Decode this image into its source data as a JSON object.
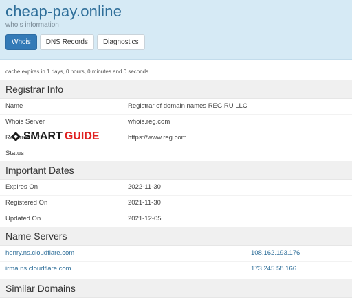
{
  "header": {
    "domain": "cheap-pay.online",
    "subtitle": "whois information",
    "tabs": [
      {
        "label": "Whois",
        "active": true
      },
      {
        "label": "DNS Records",
        "active": false
      },
      {
        "label": "Diagnostics",
        "active": false
      }
    ]
  },
  "cache_note": "cache expires in 1 days, 0 hours, 0 minutes and 0 seconds",
  "registrar": {
    "title": "Registrar Info",
    "rows": [
      {
        "key": "Name",
        "value": "Registrar of domain names REG.RU LLC"
      },
      {
        "key": "Whois Server",
        "value": "whois.reg.com"
      },
      {
        "key": "Referral URL",
        "value": "https://www.reg.com"
      },
      {
        "key": "Status",
        "value": ""
      }
    ]
  },
  "dates": {
    "title": "Important Dates",
    "rows": [
      {
        "key": "Expires On",
        "value": "2022-11-30"
      },
      {
        "key": "Registered On",
        "value": "2021-11-30"
      },
      {
        "key": "Updated On",
        "value": "2021-12-05"
      }
    ]
  },
  "nameservers": {
    "title": "Name Servers",
    "rows": [
      {
        "host": "henry.ns.cloudflare.com",
        "ip": "108.162.193.176"
      },
      {
        "host": "irma.ns.cloudflare.com",
        "ip": "173.245.58.166"
      }
    ]
  },
  "similar": {
    "title": "Similar Domains"
  },
  "watermark": {
    "part1": "SMART",
    "part2": "GUIDE"
  },
  "colors": {
    "accent": "#337ab7",
    "link": "#2e6e99",
    "header_bg": "#d6eaf5",
    "watermark_red": "#e02020"
  }
}
